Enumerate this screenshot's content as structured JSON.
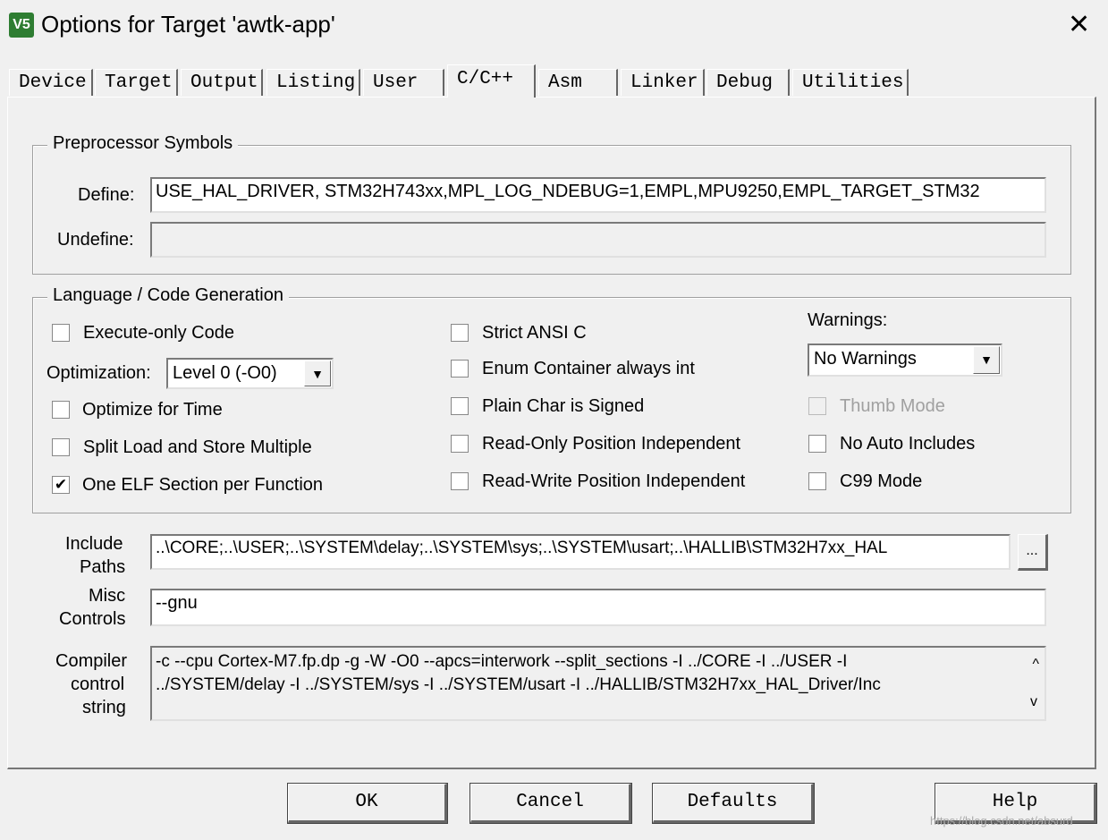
{
  "window": {
    "title": "Options for Target 'awtk-app'",
    "logo_text": "V5",
    "close": "✕"
  },
  "tabs": [
    {
      "label": "Device"
    },
    {
      "label": "Target"
    },
    {
      "label": "Output"
    },
    {
      "label": "Listing"
    },
    {
      "label": "User"
    },
    {
      "label": "C/C++",
      "selected": true
    },
    {
      "label": "Asm"
    },
    {
      "label": "Linker"
    },
    {
      "label": "Debug"
    },
    {
      "label": "Utilities"
    }
  ],
  "preprocessor": {
    "title": "Preprocessor Symbols",
    "define_label": "Define:",
    "define_value": "USE_HAL_DRIVER, STM32H743xx,MPL_LOG_NDEBUG=1,EMPL,MPU9250,EMPL_TARGET_STM32",
    "undefine_label": "Undefine:",
    "undefine_value": ""
  },
  "language": {
    "title": "Language / Code Generation",
    "execute_only": {
      "label": "Execute-only Code",
      "checked": false
    },
    "optimization_label": "Optimization:",
    "optimization_value": "Level 0 (-O0)",
    "optimize_time": {
      "label": "Optimize for Time",
      "checked": false
    },
    "split_load": {
      "label": "Split Load and Store Multiple",
      "checked": false
    },
    "one_elf": {
      "label": "One ELF Section per Function",
      "checked": true,
      "mark": "✔"
    },
    "strict_ansi": {
      "label": "Strict ANSI C",
      "checked": false
    },
    "enum_container": {
      "label": "Enum Container always int",
      "checked": false
    },
    "plain_char": {
      "label": "Plain Char is Signed",
      "checked": false
    },
    "ropi": {
      "label": "Read-Only Position Independent",
      "checked": false
    },
    "rwpi": {
      "label": "Read-Write Position Independent",
      "checked": false
    },
    "warnings_label": "Warnings:",
    "warnings_value": "No Warnings",
    "thumb_mode": {
      "label": "Thumb Mode",
      "checked": false,
      "disabled": true
    },
    "no_auto": {
      "label": "No Auto Includes",
      "checked": false
    },
    "c99": {
      "label": "C99 Mode",
      "checked": false
    }
  },
  "include": {
    "label1": "Include",
    "label2": "Paths",
    "value": "..\\CORE;..\\USER;..\\SYSTEM\\delay;..\\SYSTEM\\sys;..\\SYSTEM\\usart;..\\HALLIB\\STM32H7xx_HAL",
    "browse": "..."
  },
  "misc": {
    "label1": "Misc",
    "label2": "Controls",
    "value": "--gnu"
  },
  "compiler": {
    "label1": "Compiler",
    "label2": "control",
    "label3": "string",
    "line1": "-c --cpu Cortex-M7.fp.dp -g -W -O0 --apcs=interwork --split_sections -I ../CORE -I ../USER -I",
    "line2": "../SYSTEM/delay -I ../SYSTEM/sys -I ../SYSTEM/usart -I ../HALLIB/STM32H7xx_HAL_Driver/Inc",
    "up": "^",
    "down": "v"
  },
  "buttons": {
    "ok": "OK",
    "cancel": "Cancel",
    "defaults": "Defaults",
    "help": "Help"
  },
  "watermark": "https://blog.csdn.net/absurd"
}
